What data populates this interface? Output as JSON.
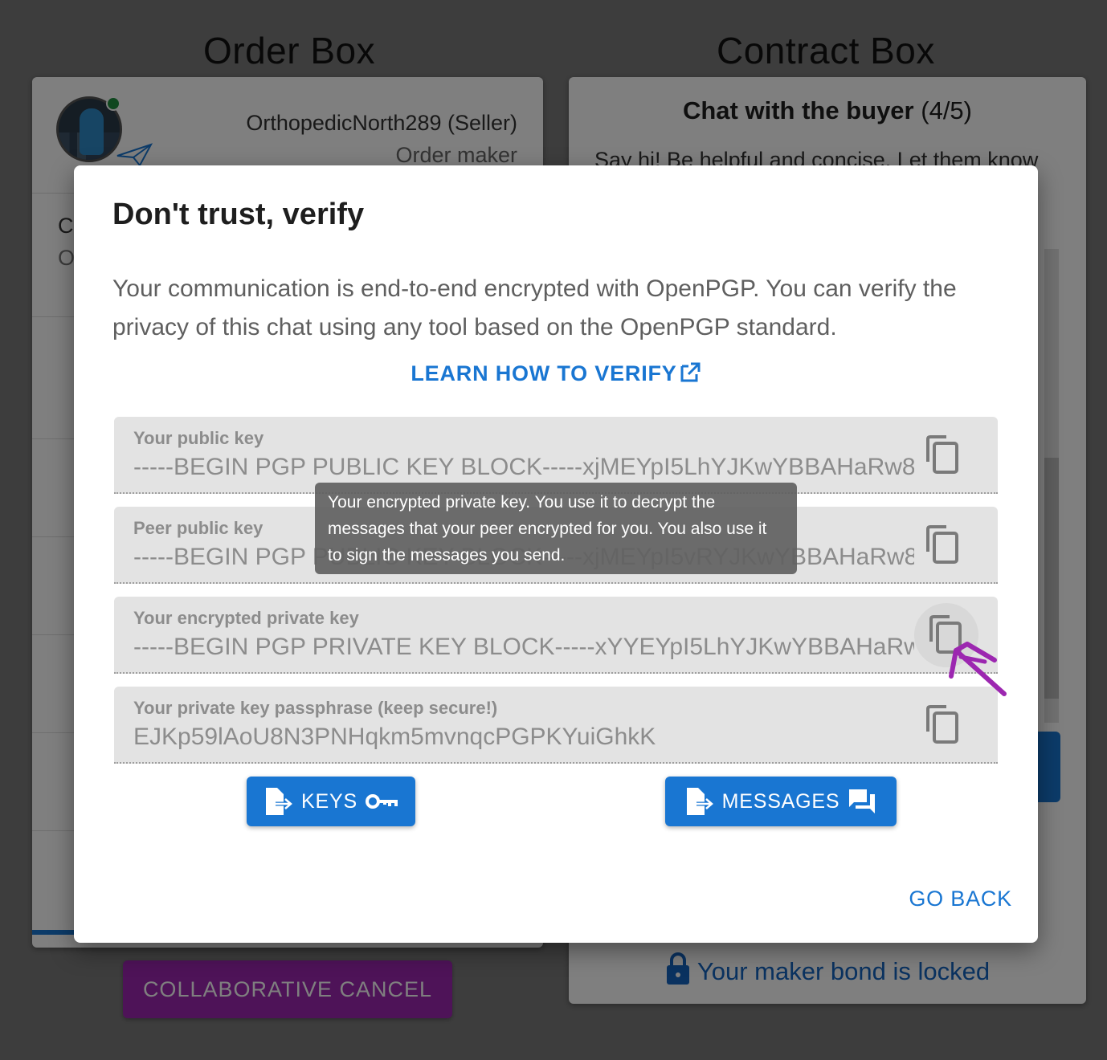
{
  "background": {
    "order_title": "Order Box",
    "contract_title": "Contract Box",
    "maker": {
      "name": "OrthopedicNorth289 (Seller)",
      "role": "Order maker"
    },
    "order_stubs": [
      "C",
      "O"
    ],
    "chat": {
      "title_bold": "Chat with the buyer",
      "title_count": "(4/5)",
      "hint": "Say hi! Be helpful and concise. Let them know"
    },
    "bond_status": "Your maker bond is locked",
    "collaborative_cancel_label": "COLLABORATIVE CANCEL"
  },
  "dialog": {
    "title": "Don't trust, verify",
    "body": "Your communication is end-to-end encrypted with OpenPGP. You can verify the privacy of this chat using any tool based on the OpenPGP standard.",
    "learn_link": "LEARN HOW TO VERIFY",
    "fields": [
      {
        "label": "Your public key",
        "value": "-----BEGIN PGP PUBLIC KEY BLOCK-----xjMEYpI5LhYJKwYBBAHaRw8"
      },
      {
        "label": "Peer public key",
        "value": "-----BEGIN PGP PUBLIC KEY BLOCK-----xjMEYpI5vRYJKwYBBAHaRw8"
      },
      {
        "label": "Your encrypted private key",
        "value": "-----BEGIN PGP PRIVATE KEY BLOCK-----xYYEYpI5LhYJKwYBBAHaRw"
      },
      {
        "label": "Your private key passphrase (keep secure!)",
        "value": "EJKp59lAoU8N3PNHqkm5mvnqcPGPKYuiGhkK"
      }
    ],
    "tooltip": "Your encrypted private key. You use it to decrypt the messages that your peer encrypted for you. You also use it to sign the messages you send.",
    "keys_button": "KEYS",
    "messages_button": "MESSAGES",
    "go_back": "GO BACK"
  },
  "colors": {
    "primary": "#1976d2",
    "secondary": "#9c27b0",
    "annotation": "#9c27b0"
  }
}
